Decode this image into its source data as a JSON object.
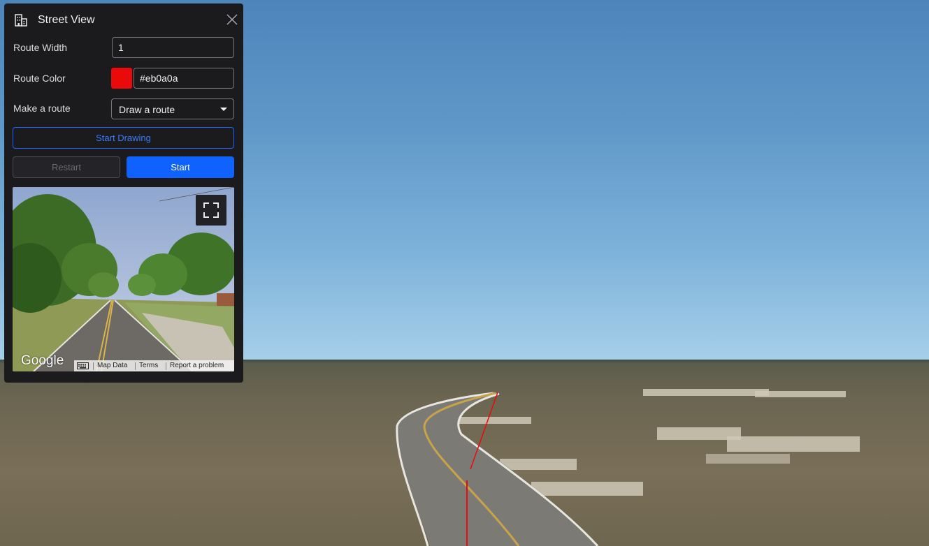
{
  "panel": {
    "title": "Street View",
    "title_icon": "building-icon",
    "close_icon": "close-icon",
    "route_width": {
      "label": "Route Width",
      "value": "1"
    },
    "route_color": {
      "label": "Route Color",
      "value": "#eb0a0a",
      "swatch_color": "#eb0a0a"
    },
    "make_route": {
      "label": "Make a route",
      "selected": "Draw a route"
    },
    "buttons": {
      "start_drawing": "Start Drawing",
      "restart": "Restart",
      "start": "Start"
    }
  },
  "street_view": {
    "logo": "Google",
    "keyboard_icon": "keyboard-icon",
    "fullscreen_icon": "fullscreen-icon",
    "footer_links": [
      "Map Data",
      "Terms",
      "Report a problem"
    ]
  },
  "colors": {
    "accent": "#0f62fe",
    "route": "#eb0a0a",
    "panel_bg": "#1b1b1e"
  }
}
